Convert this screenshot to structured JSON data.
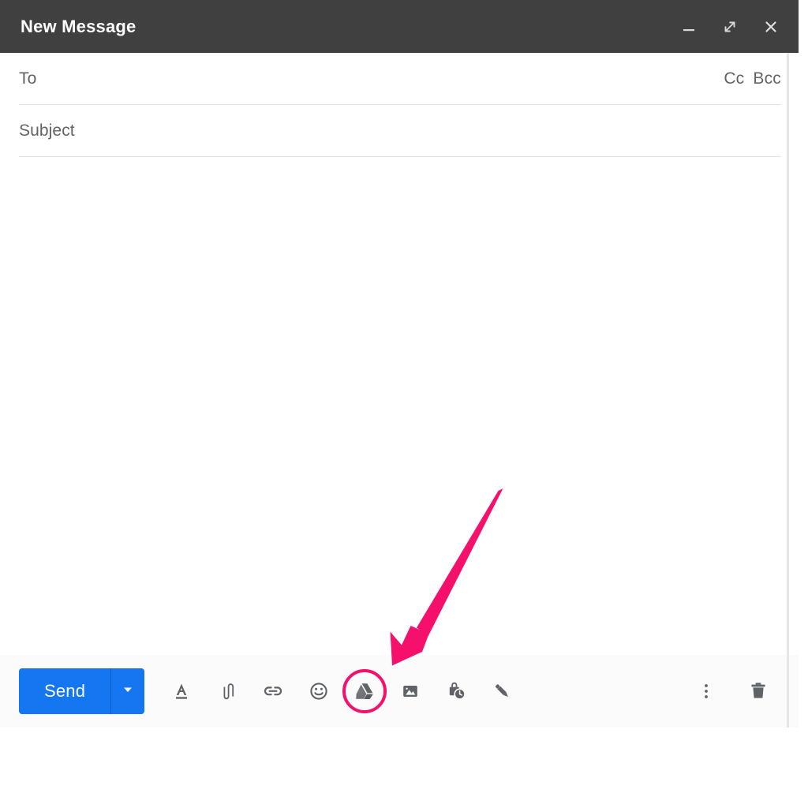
{
  "window": {
    "title": "New Message",
    "titlebar_bg": "#404040",
    "controls": [
      {
        "name": "minimize",
        "label": "Minimize",
        "icon": "minimize-icon"
      },
      {
        "name": "expand",
        "label": "Full screen",
        "icon": "expand-icon"
      },
      {
        "name": "close",
        "label": "Close",
        "icon": "close-icon"
      }
    ]
  },
  "fields": {
    "to": {
      "label": "To",
      "placeholder": "To",
      "value": ""
    },
    "cc": {
      "label": "Cc"
    },
    "bcc": {
      "label": "Bcc"
    },
    "subject": {
      "label": "Subject",
      "placeholder": "Subject",
      "value": ""
    }
  },
  "body": {
    "value": "",
    "placeholder": ""
  },
  "toolbar": {
    "send_label": "Send",
    "send_color": "#1476f0",
    "send_dropdown_icon": "chevron-down-icon",
    "items": [
      {
        "name": "formatting-options",
        "label": "Formatting options",
        "icon": "format-text-icon"
      },
      {
        "name": "attach-files",
        "label": "Attach files",
        "icon": "paperclip-icon"
      },
      {
        "name": "insert-link",
        "label": "Insert link",
        "icon": "link-icon"
      },
      {
        "name": "insert-emoji",
        "label": "Insert emoji",
        "icon": "emoji-icon"
      },
      {
        "name": "insert-drive-files",
        "label": "Insert files using Drive",
        "icon": "google-drive-icon",
        "highlighted": true
      },
      {
        "name": "insert-photo",
        "label": "Insert photo",
        "icon": "image-icon"
      },
      {
        "name": "confidential-mode",
        "label": "Toggle confidential mode",
        "icon": "lock-clock-icon"
      },
      {
        "name": "insert-signature",
        "label": "Insert signature",
        "icon": "pen-icon"
      }
    ],
    "right_items": [
      {
        "name": "more-options",
        "label": "More options",
        "icon": "more-vertical-icon"
      },
      {
        "name": "discard-draft",
        "label": "Discard draft",
        "icon": "trash-icon"
      }
    ]
  },
  "annotation": {
    "type": "arrow",
    "color": "#f5116b",
    "target": "insert-drive-files",
    "highlight_color": "#f5116b"
  }
}
